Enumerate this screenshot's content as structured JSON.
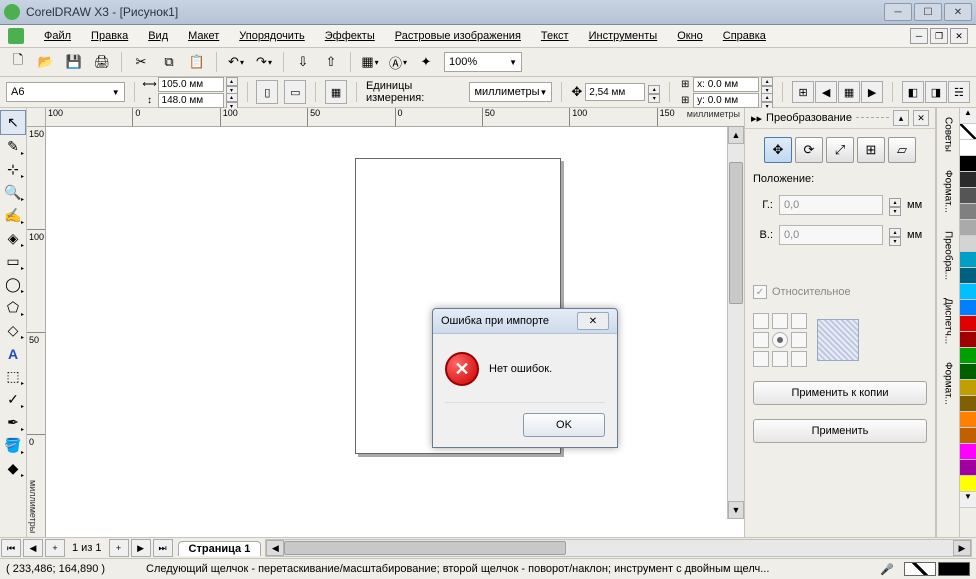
{
  "titlebar": {
    "app": "CorelDRAW X3",
    "doc": "[Рисунок1]"
  },
  "menu": [
    "Файл",
    "Правка",
    "Вид",
    "Макет",
    "Упорядочить",
    "Эффекты",
    "Растровые изображения",
    "Текст",
    "Инструменты",
    "Окно",
    "Справка"
  ],
  "zoom": "100%",
  "propbar": {
    "paper": "A6",
    "width": "105.0 мм",
    "height": "148.0 мм",
    "units_label": "Единицы измерения:",
    "units": "миллиметры",
    "nudge": "2,54 мм",
    "dup_x": "x: 0.0 мм",
    "dup_y": "y: 0.0 мм"
  },
  "ruler": {
    "unit_h": "миллиметры",
    "unit_v": "миллиметры",
    "h_ticks": [
      "100",
      "0",
      "100",
      "50",
      "0",
      "50",
      "100",
      "150"
    ],
    "v_ticks": [
      "150",
      "100",
      "50",
      "0"
    ]
  },
  "docker": {
    "title": "Преобразование",
    "section": "Положение:",
    "h_label": "Г.:",
    "v_label": "В.:",
    "h_val": "0,0",
    "v_val": "0,0",
    "unit": "мм",
    "relative": "Относительное",
    "apply_copy": "Применить к копии",
    "apply": "Применить"
  },
  "side_tabs": [
    "Советы",
    "Формат...",
    "Преобра...",
    "Диспетч...",
    "Формат..."
  ],
  "palette": [
    "#ffffff",
    "#000000",
    "#2b2b2b",
    "#555555",
    "#808080",
    "#aaaaaa",
    "#d4d4d4",
    "#00a0c6",
    "#006080",
    "#00c0ff",
    "#0080ff",
    "#e00000",
    "#a00000",
    "#00a000",
    "#006000",
    "#c0a000",
    "#806000",
    "#ff8000",
    "#c06000",
    "#ff00ff",
    "#a000a0",
    "#ffff00"
  ],
  "pagenav": {
    "counter": "1 из 1",
    "tab": "Страница 1"
  },
  "status": {
    "coords": "( 233,486; 164,890 )",
    "hint": "Следующий щелчок - перетаскивание/масштабирование; второй щелчок - поворот/наклон; инструмент с двойным щелч..."
  },
  "dialog": {
    "title": "Ошибка при импорте",
    "message": "Нет ошибок.",
    "ok": "OK"
  }
}
